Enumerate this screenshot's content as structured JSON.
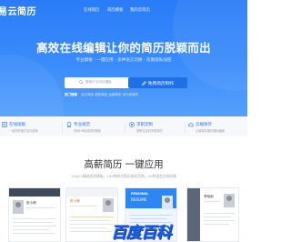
{
  "header": {
    "logo_text": "易云简历",
    "nav": [
      "在线简历",
      "简历模板",
      "我的云简历"
    ]
  },
  "hero": {
    "headline": "高效在线编辑让你的简历脱颖而出",
    "subline": "专业模板 · 一键应用 · 多种语言切换 · 双重隐私加密",
    "search_placeholder": "搜索行业岗位模板",
    "cta_label": "免费简历制作",
    "hot_label": "热门搜索",
    "hot_terms": [
      "会计简历",
      "销售简历",
      "运营简历",
      "设计师简历"
    ]
  },
  "features": [
    {
      "title": "在线排版",
      "desc": "一键简历格式自动排版",
      "icon": "layout-icon"
    },
    {
      "title": "专业规范",
      "desc": "资深HR精选简历模板",
      "icon": "badge-icon"
    },
    {
      "title": "求职定制",
      "desc": "按职位定制专属简历",
      "icon": "target-icon"
    },
    {
      "title": "云端保存",
      "desc": "云端保存随时随地编辑",
      "icon": "cloud-icon"
    }
  ],
  "section": {
    "title": "高薪简历 一键应用",
    "subtitle": "1200+精选优质模板，100种岗位简历指导范例，20种语言在线切换"
  },
  "cards": [
    {
      "name": "张小明"
    },
    {
      "name": "陈小静"
    },
    {
      "tag": "PERSONAL",
      "name": "RESUME"
    },
    {
      "name": "李晓雨"
    }
  ],
  "watermark": {
    "text": "百度百科"
  },
  "colors": {
    "brand": "#2a7cf8",
    "cta": "#1f6fe9",
    "feature_text": "#2e74e8"
  }
}
